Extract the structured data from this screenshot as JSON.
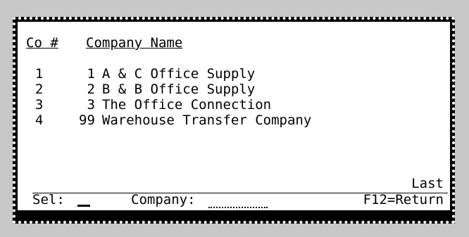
{
  "header": {
    "co_number": "Co #",
    "company_name": "Company Name"
  },
  "rows": [
    {
      "line": "1",
      "co": "1",
      "name": "A & C Office Supply"
    },
    {
      "line": "2",
      "co": "2",
      "name": "B & B Office Supply"
    },
    {
      "line": "3",
      "co": "3",
      "name": "The Office Connection"
    },
    {
      "line": "4",
      "co": "99",
      "name": "Warehouse Transfer Company"
    }
  ],
  "status": {
    "last": "Last"
  },
  "footer": {
    "sel_label": "Sel:",
    "sel_value": "",
    "company_label": "Company:",
    "company_value": "",
    "f12": "F12=Return"
  },
  "colors": {
    "frame": "#c8c8c8",
    "border": "#000000",
    "screen": "#ffffff",
    "text": "#000000"
  }
}
